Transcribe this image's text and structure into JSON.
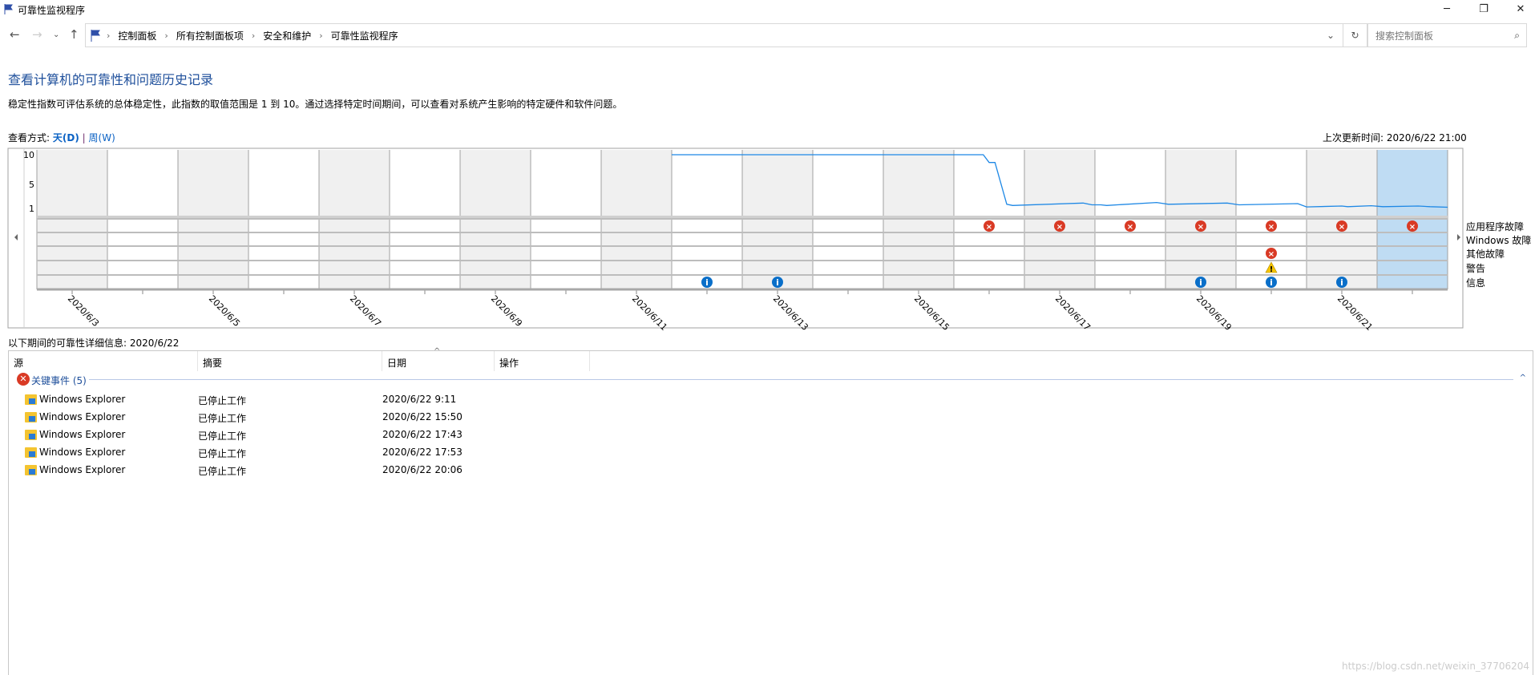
{
  "window": {
    "title": "可靠性监视程序",
    "controls": [
      "minimize",
      "restore",
      "close"
    ]
  },
  "nav": {
    "breadcrumb": [
      "控制面板",
      "所有控制面板项",
      "安全和维护",
      "可靠性监视程序"
    ],
    "search_placeholder": "搜索控制面板"
  },
  "page": {
    "heading": "查看计算机的可靠性和问题历史记录",
    "description": "稳定性指数可评估系统的总体稳定性，此指数的取值范围是 1 到 10。通过选择特定时间期间，可以查看对系统产生影响的特定硬件和软件问题。",
    "view_label": "查看方式:",
    "view_day": "天(D)",
    "view_sep": "|",
    "view_week": "周(W)",
    "last_update": "上次更新时间: 2020/6/22 21:00",
    "detail_label": "以下期间的可靠性详细信息: 2020/6/22"
  },
  "chart_data": {
    "type": "line",
    "days": [
      "2020/6/3",
      "2020/6/4",
      "2020/6/5",
      "2020/6/6",
      "2020/6/7",
      "2020/6/8",
      "2020/6/9",
      "2020/6/10",
      "2020/6/11",
      "2020/6/12",
      "2020/6/13",
      "2020/6/14",
      "2020/6/15",
      "2020/6/16",
      "2020/6/17",
      "2020/6/18",
      "2020/6/19",
      "2020/6/20",
      "2020/6/21",
      "2020/6/22"
    ],
    "date_labels": [
      "2020/6/3",
      "2020/6/5",
      "2020/6/7",
      "2020/6/9",
      "2020/6/11",
      "2020/6/13",
      "2020/6/15",
      "2020/6/17",
      "2020/6/19",
      "2020/6/21"
    ],
    "selected_day": "2020/6/22",
    "y_ticks": [
      "10",
      "5",
      "1"
    ],
    "ylim": [
      1,
      10
    ],
    "series": [
      {
        "points": [
          [
            "2020/6/12 0:00",
            10
          ],
          [
            "2020/6/16 10:00",
            10
          ],
          [
            "2020/6/16 12:00",
            8.7
          ],
          [
            "2020/6/16 14:00",
            8.7
          ],
          [
            "2020/6/16 18:00",
            1.7
          ],
          [
            "2020/6/16 20:00",
            1.5
          ],
          [
            "2020/6/17 20:00",
            1.9
          ],
          [
            "2020/6/17 23:00",
            1.6
          ],
          [
            "2020/6/18 2:00",
            1.6
          ],
          [
            "2020/6/18 4:00",
            1.5
          ],
          [
            "2020/6/18 21:00",
            2.0
          ],
          [
            "2020/6/19 1:00",
            1.7
          ],
          [
            "2020/6/19 21:00",
            1.9
          ],
          [
            "2020/6/20 1:00",
            1.6
          ],
          [
            "2020/6/20 21:00",
            1.8
          ],
          [
            "2020/6/21 0:00",
            1.25
          ],
          [
            "2020/6/21 12:00",
            1.4
          ],
          [
            "2020/6/21 14:00",
            1.3
          ],
          [
            "2020/6/21 22:00",
            1.45
          ],
          [
            "2020/6/22 2:00",
            1.3
          ],
          [
            "2020/6/22 14:00",
            1.4
          ],
          [
            "2020/6/22 18:00",
            1.3
          ],
          [
            "2020/6/23 0:00",
            1.2
          ]
        ]
      }
    ],
    "event_rows": [
      "应用程序故障",
      "Windows 故障",
      "其他故障",
      "警告",
      "信息"
    ],
    "events": [
      {
        "row": 0,
        "type": "error",
        "days": [
          "2020/6/16",
          "2020/6/17",
          "2020/6/18",
          "2020/6/19",
          "2020/6/20",
          "2020/6/21",
          "2020/6/22"
        ]
      },
      {
        "row": 2,
        "type": "error",
        "days": [
          "2020/6/20"
        ]
      },
      {
        "row": 3,
        "type": "warning",
        "days": [
          "2020/6/20"
        ]
      },
      {
        "row": 4,
        "type": "info",
        "days": [
          "2020/6/12",
          "2020/6/13",
          "2020/6/19",
          "2020/6/20",
          "2020/6/21"
        ]
      }
    ],
    "colors": {
      "line": "#1e88e5",
      "selected": "#bfdcf3",
      "shade": "#f0f0f0",
      "error": "#d93a25",
      "warning": "#f5c400",
      "info": "#0a6fc9"
    }
  },
  "list": {
    "columns": [
      "源",
      "摘要",
      "日期",
      "操作"
    ],
    "group": "关键事件 (5)",
    "rows": [
      {
        "source": "Windows Explorer",
        "summary": "已停止工作",
        "date": "2020/6/22 9:11"
      },
      {
        "source": "Windows Explorer",
        "summary": "已停止工作",
        "date": "2020/6/22 15:50"
      },
      {
        "source": "Windows Explorer",
        "summary": "已停止工作",
        "date": "2020/6/22 17:43"
      },
      {
        "source": "Windows Explorer",
        "summary": "已停止工作",
        "date": "2020/6/22 17:53"
      },
      {
        "source": "Windows Explorer",
        "summary": "已停止工作",
        "date": "2020/6/22 20:06"
      }
    ]
  },
  "watermark": "https://blog.csdn.net/weixin_37706204"
}
